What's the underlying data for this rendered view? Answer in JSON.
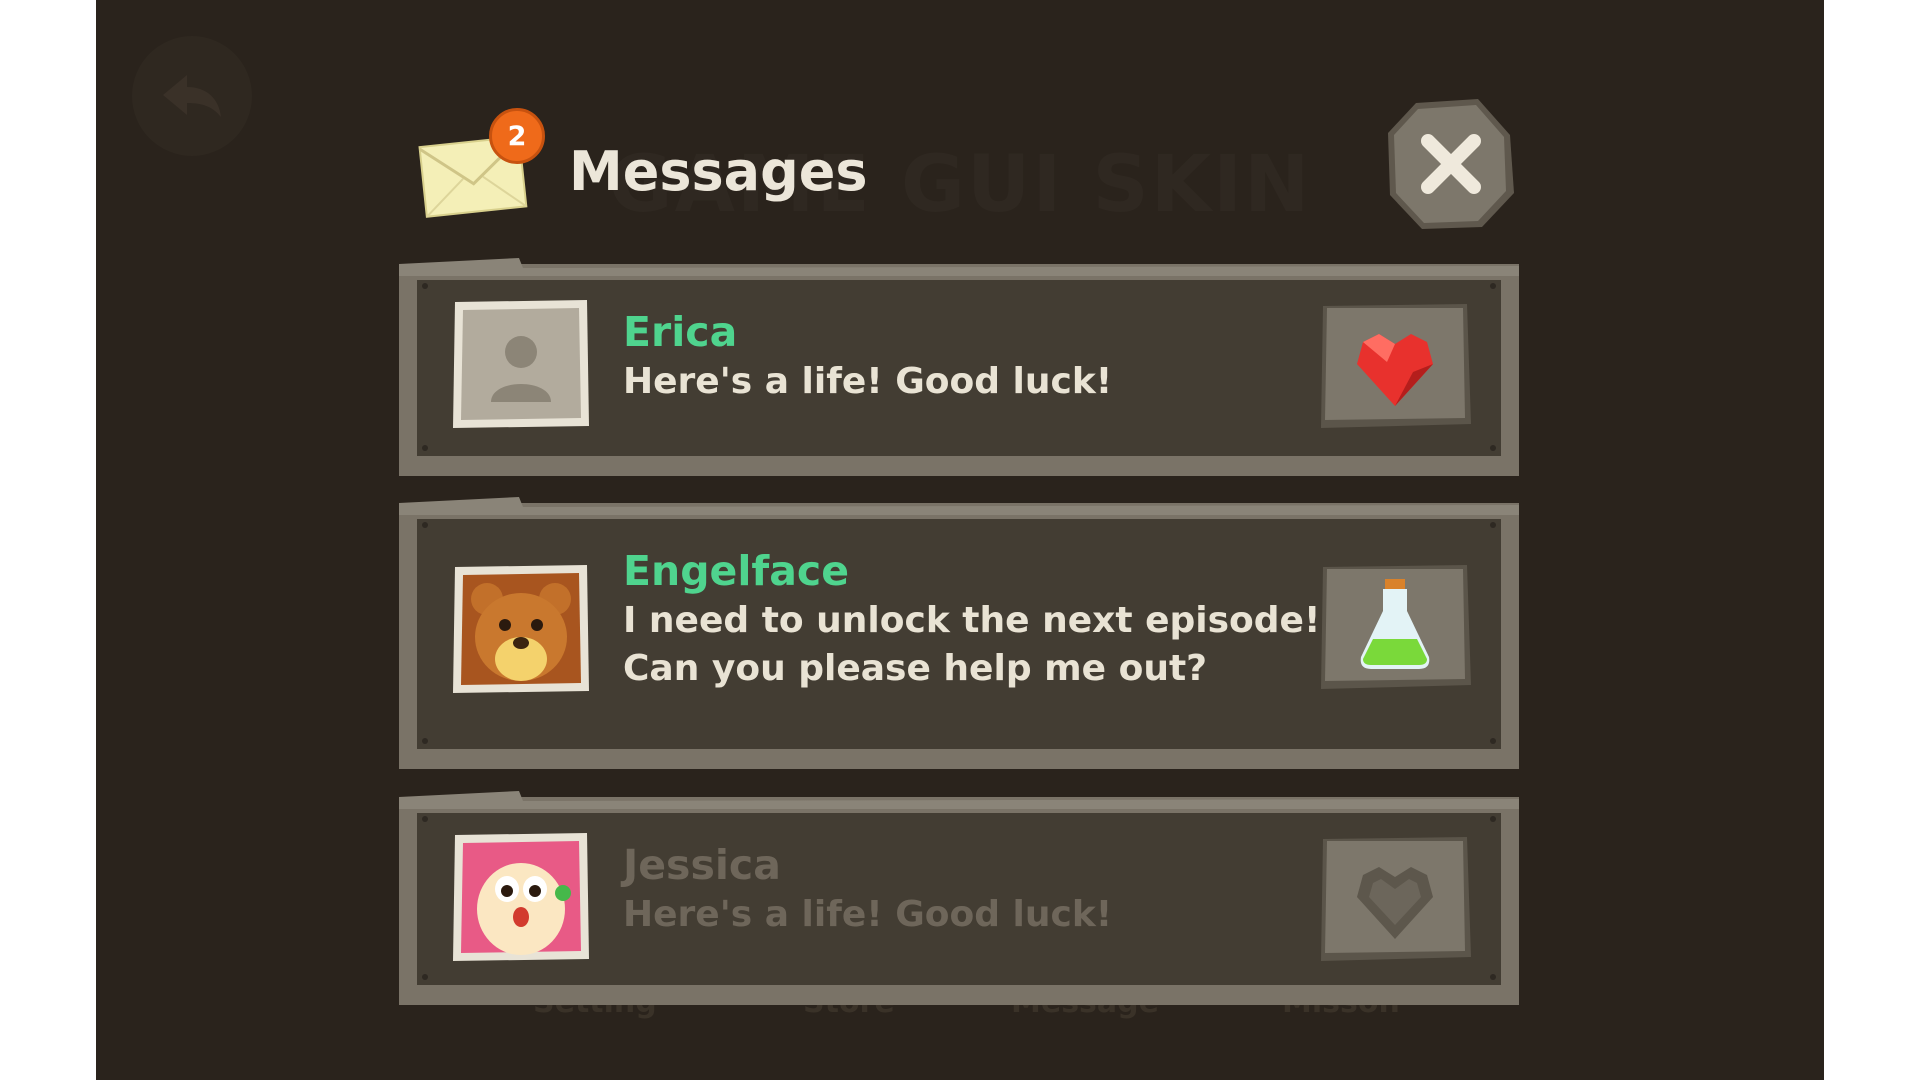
{
  "background": {
    "title": "GAME GUI SKIN",
    "nav": [
      "Setting",
      "Store",
      "Message",
      "Misson"
    ]
  },
  "header": {
    "title": "Messages",
    "badge_count": "2"
  },
  "messages": [
    {
      "name": "Erica",
      "lines": [
        "Here's a life! Good luck!"
      ],
      "avatar": "silhouette-avatar",
      "gift": "heart-icon",
      "state": "active"
    },
    {
      "name": "Engelface",
      "lines": [
        "I need to unlock the next episode!",
        "Can you please help me out?"
      ],
      "avatar": "bear-avatar",
      "gift": "potion-icon",
      "state": "active"
    },
    {
      "name": "Jessica",
      "lines": [
        "Here's a life! Good luck!"
      ],
      "avatar": "bunny-avatar",
      "gift": "heart-icon",
      "state": "faded"
    }
  ],
  "colors": {
    "name_active": "#4fd48e",
    "badge": "#ef6a1a",
    "heart": "#e8312d",
    "potion": "#7ad93a"
  }
}
